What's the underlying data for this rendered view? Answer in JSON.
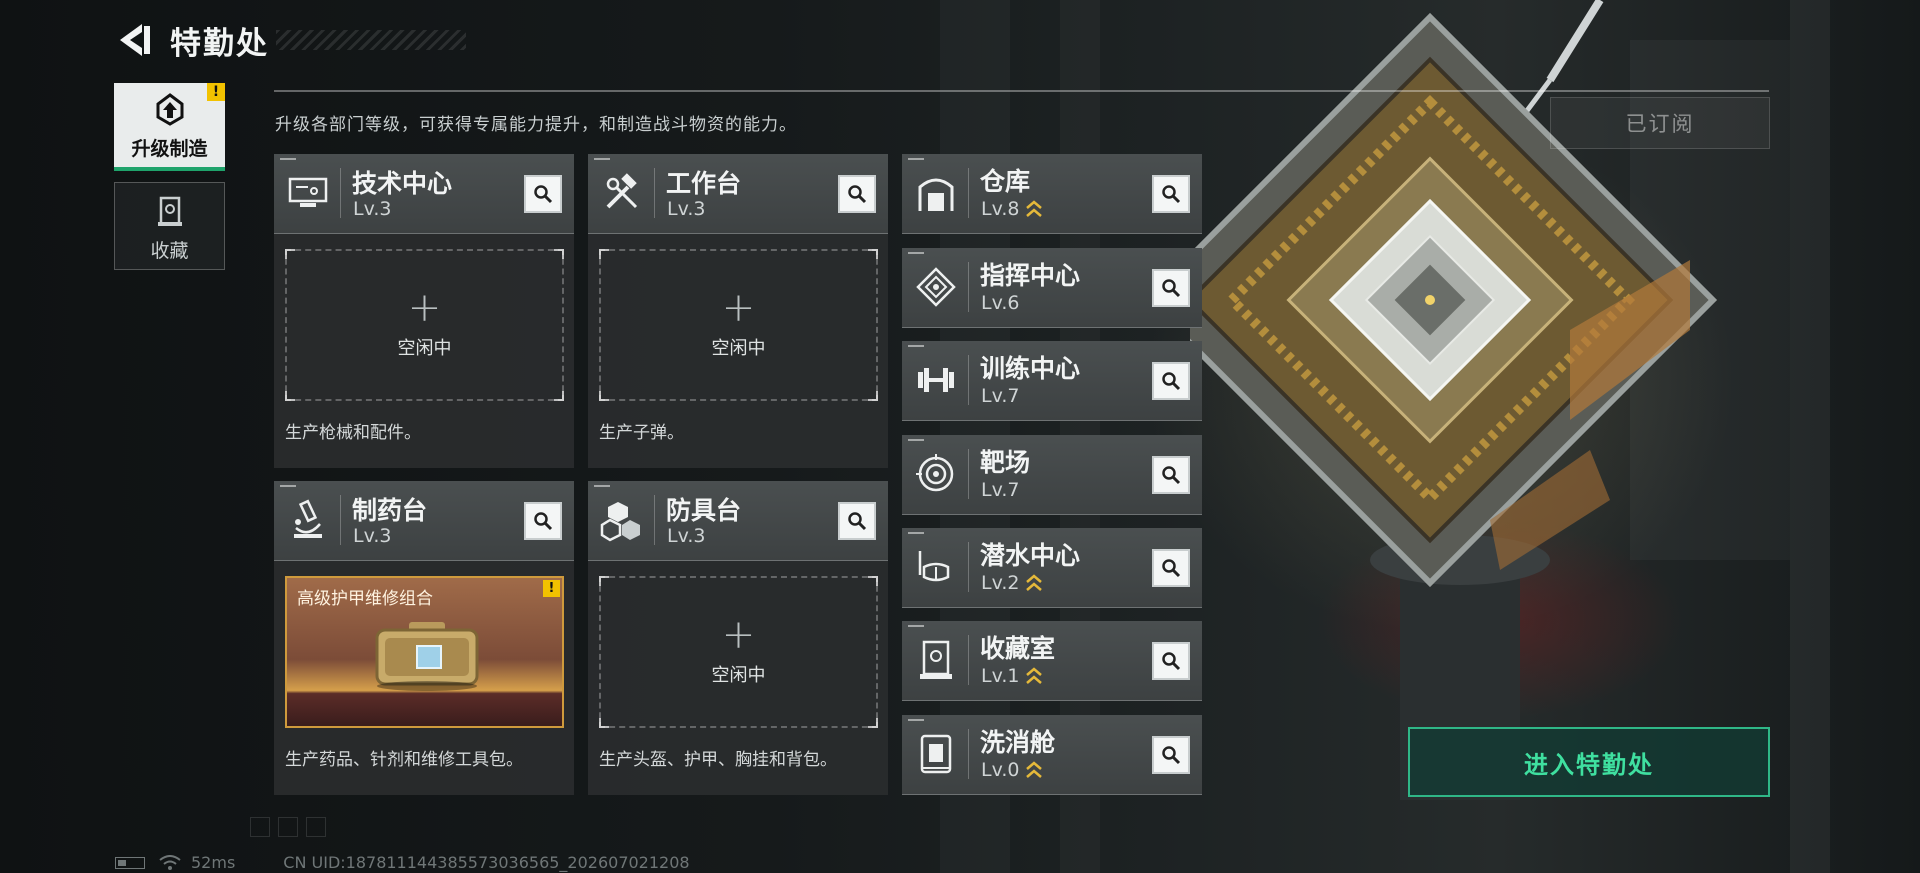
{
  "header": {
    "title": "特勤处",
    "subtitle": "升级各部门等级，可获得专属能力提升，和制造战斗物资的能力。",
    "subscribed_label": "已订阅"
  },
  "sidebar": {
    "tabs": [
      {
        "label": "升级制造",
        "icon": "upgrade-craft-icon",
        "active": true,
        "warn": "!"
      },
      {
        "label": "收藏",
        "icon": "collection-icon",
        "active": false
      }
    ]
  },
  "workbenches": [
    {
      "name": "技术中心",
      "level": "Lv.3",
      "icon": "monitor-icon",
      "slot_state": "空闲中",
      "slot_plus": "+",
      "description": "生产枪械和配件。"
    },
    {
      "name": "工作台",
      "level": "Lv.3",
      "icon": "hammer-wrench-icon",
      "slot_state": "空闲中",
      "slot_plus": "+",
      "description": "生产子弹。"
    },
    {
      "name": "制药台",
      "level": "Lv.3",
      "icon": "microscope-icon",
      "product": {
        "name": "高级护甲维修组合",
        "warn": "!"
      },
      "description": "生产药品、针剂和维修工具包。"
    },
    {
      "name": "防具台",
      "level": "Lv.3",
      "icon": "armor-blocks-icon",
      "slot_state": "空闲中",
      "slot_plus": "+",
      "description": "生产头盔、护甲、胸挂和背包。"
    }
  ],
  "facilities": [
    {
      "name": "仓库",
      "level": "Lv.8",
      "icon": "warehouse-icon",
      "upgradable": true
    },
    {
      "name": "指挥中心",
      "level": "Lv.6",
      "icon": "command-chip-icon",
      "upgradable": false
    },
    {
      "name": "训练中心",
      "level": "Lv.7",
      "icon": "dumbbell-icon",
      "upgradable": false
    },
    {
      "name": "靶场",
      "level": "Lv.7",
      "icon": "target-icon",
      "upgradable": false
    },
    {
      "name": "潜水中心",
      "level": "Lv.2",
      "icon": "diving-mask-icon",
      "upgradable": true
    },
    {
      "name": "收藏室",
      "level": "Lv.1",
      "icon": "display-case-icon",
      "upgradable": true
    },
    {
      "name": "洗消舱",
      "level": "Lv.0",
      "icon": "decon-pod-icon",
      "upgradable": true
    }
  ],
  "enter_button": "进入特勤处",
  "status_bar": {
    "ping": "52ms",
    "uid": "CN UID:1878111443855730365​65_202607021208"
  },
  "colors": {
    "accent_green": "#2fb787",
    "warn_yellow": "#f2c200",
    "upgrade_chevron": "#e5b93a"
  }
}
